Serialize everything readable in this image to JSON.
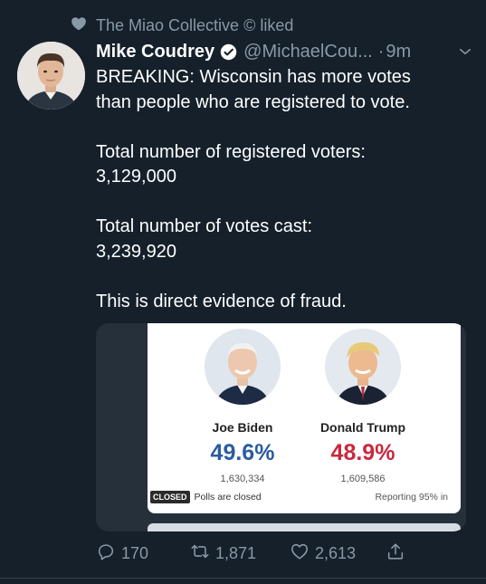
{
  "social_context": {
    "text": "The Miao Collective © liked"
  },
  "tweet": {
    "display_name": "Mike Coudrey",
    "handle": "@MichaelCou...",
    "separator": "·",
    "time": "9m",
    "body_lines": [
      "BREAKING: Wisconsin has more votes",
      "than people who are registered to vote.",
      "",
      "Total number of registered voters:",
      "3,129,000",
      "",
      "Total number of votes cast:",
      "3,239,920",
      "",
      "This is direct evidence of fraud."
    ]
  },
  "media": {
    "candidates": [
      {
        "name": "Joe Biden",
        "percent": "49.6%",
        "votes": "1,630,334",
        "color": "#2a5c9e"
      },
      {
        "name": "Donald Trump",
        "percent": "48.9%",
        "votes": "1,609,586",
        "color": "#c9283e"
      }
    ],
    "status_badge": "CLOSED",
    "status_text": "Polls are closed",
    "reporting": "Reporting 95% in"
  },
  "actions": {
    "replies": "170",
    "retweets": "1,871",
    "likes": "2,613"
  },
  "icons": {
    "social_context": "heart-icon",
    "verified": "verified-badge-icon",
    "caret": "chevron-down-icon",
    "reply": "reply-icon",
    "retweet": "retweet-icon",
    "like": "like-icon",
    "share": "share-icon"
  },
  "colors": {
    "background": "#15202b",
    "secondary_text": "#8899a6",
    "biden_blue": "#2a5c9e",
    "trump_red": "#c9283e"
  }
}
